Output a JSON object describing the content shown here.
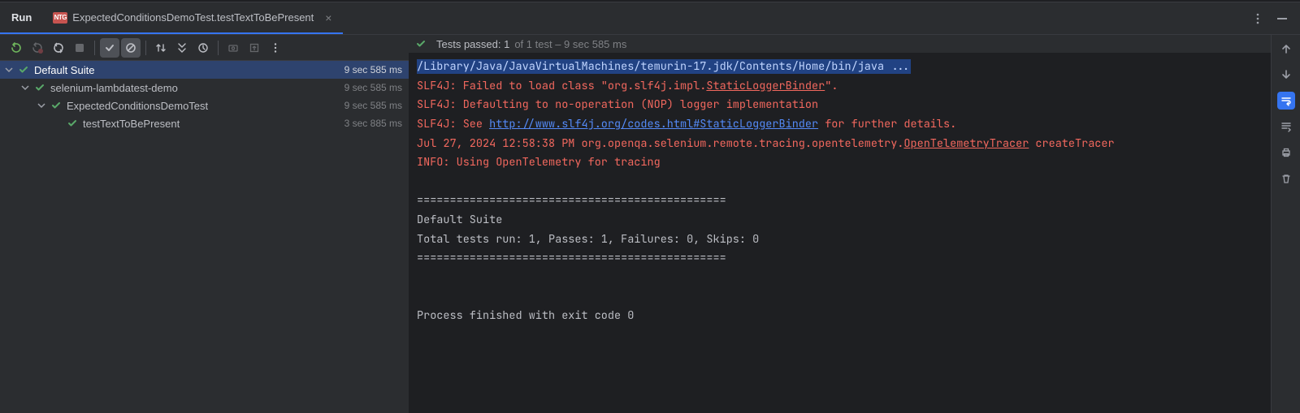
{
  "tabs": {
    "run_label": "Run",
    "file_badge": "NTG",
    "file_label": "ExpectedConditionsDemoTest.testTextToBePresent"
  },
  "top_actions": {
    "more": "⋮",
    "minimize": "—"
  },
  "tests_header": {
    "passed_label": "Tests passed: 1",
    "summary_rest": " of 1 test – 9 sec 585 ms"
  },
  "tree": {
    "root": {
      "label": "Default Suite",
      "time": "9 sec 585 ms"
    },
    "module": {
      "label": "selenium-lambdatest-demo",
      "time": "9 sec 585 ms"
    },
    "cls": {
      "label": "ExpectedConditionsDemoTest",
      "time": "9 sec 585 ms"
    },
    "test": {
      "label": "testTextToBePresent",
      "time": "3 sec 885 ms"
    }
  },
  "console": {
    "cmd": "/Library/Java/JavaVirtualMachines/temurin-17.jdk/Contents/Home/bin/java ...",
    "l1a": "SLF4J: Failed to load class \"org.slf4j.impl.",
    "l1b": "StaticLoggerBinder",
    "l1c": "\".",
    "l2": "SLF4J: Defaulting to no-operation (NOP) logger implementation",
    "l3a": "SLF4J: See ",
    "l3b": "http://www.slf4j.org/codes.html#StaticLoggerBinder",
    "l3c": " for further details.",
    "l4a": "Jul 27, 2024 12:58:38 PM org.openqa.selenium.remote.tracing.opentelemetry.",
    "l4b": "OpenTelemetryTracer",
    "l4c": " createTracer",
    "l5": "INFO: Using OpenTelemetry for tracing",
    "sep": "===============================================",
    "suite": "Default Suite",
    "totals": "Total tests run: 1, Passes: 1, Failures: 0, Skips: 0",
    "exit": "Process finished with exit code 0"
  }
}
